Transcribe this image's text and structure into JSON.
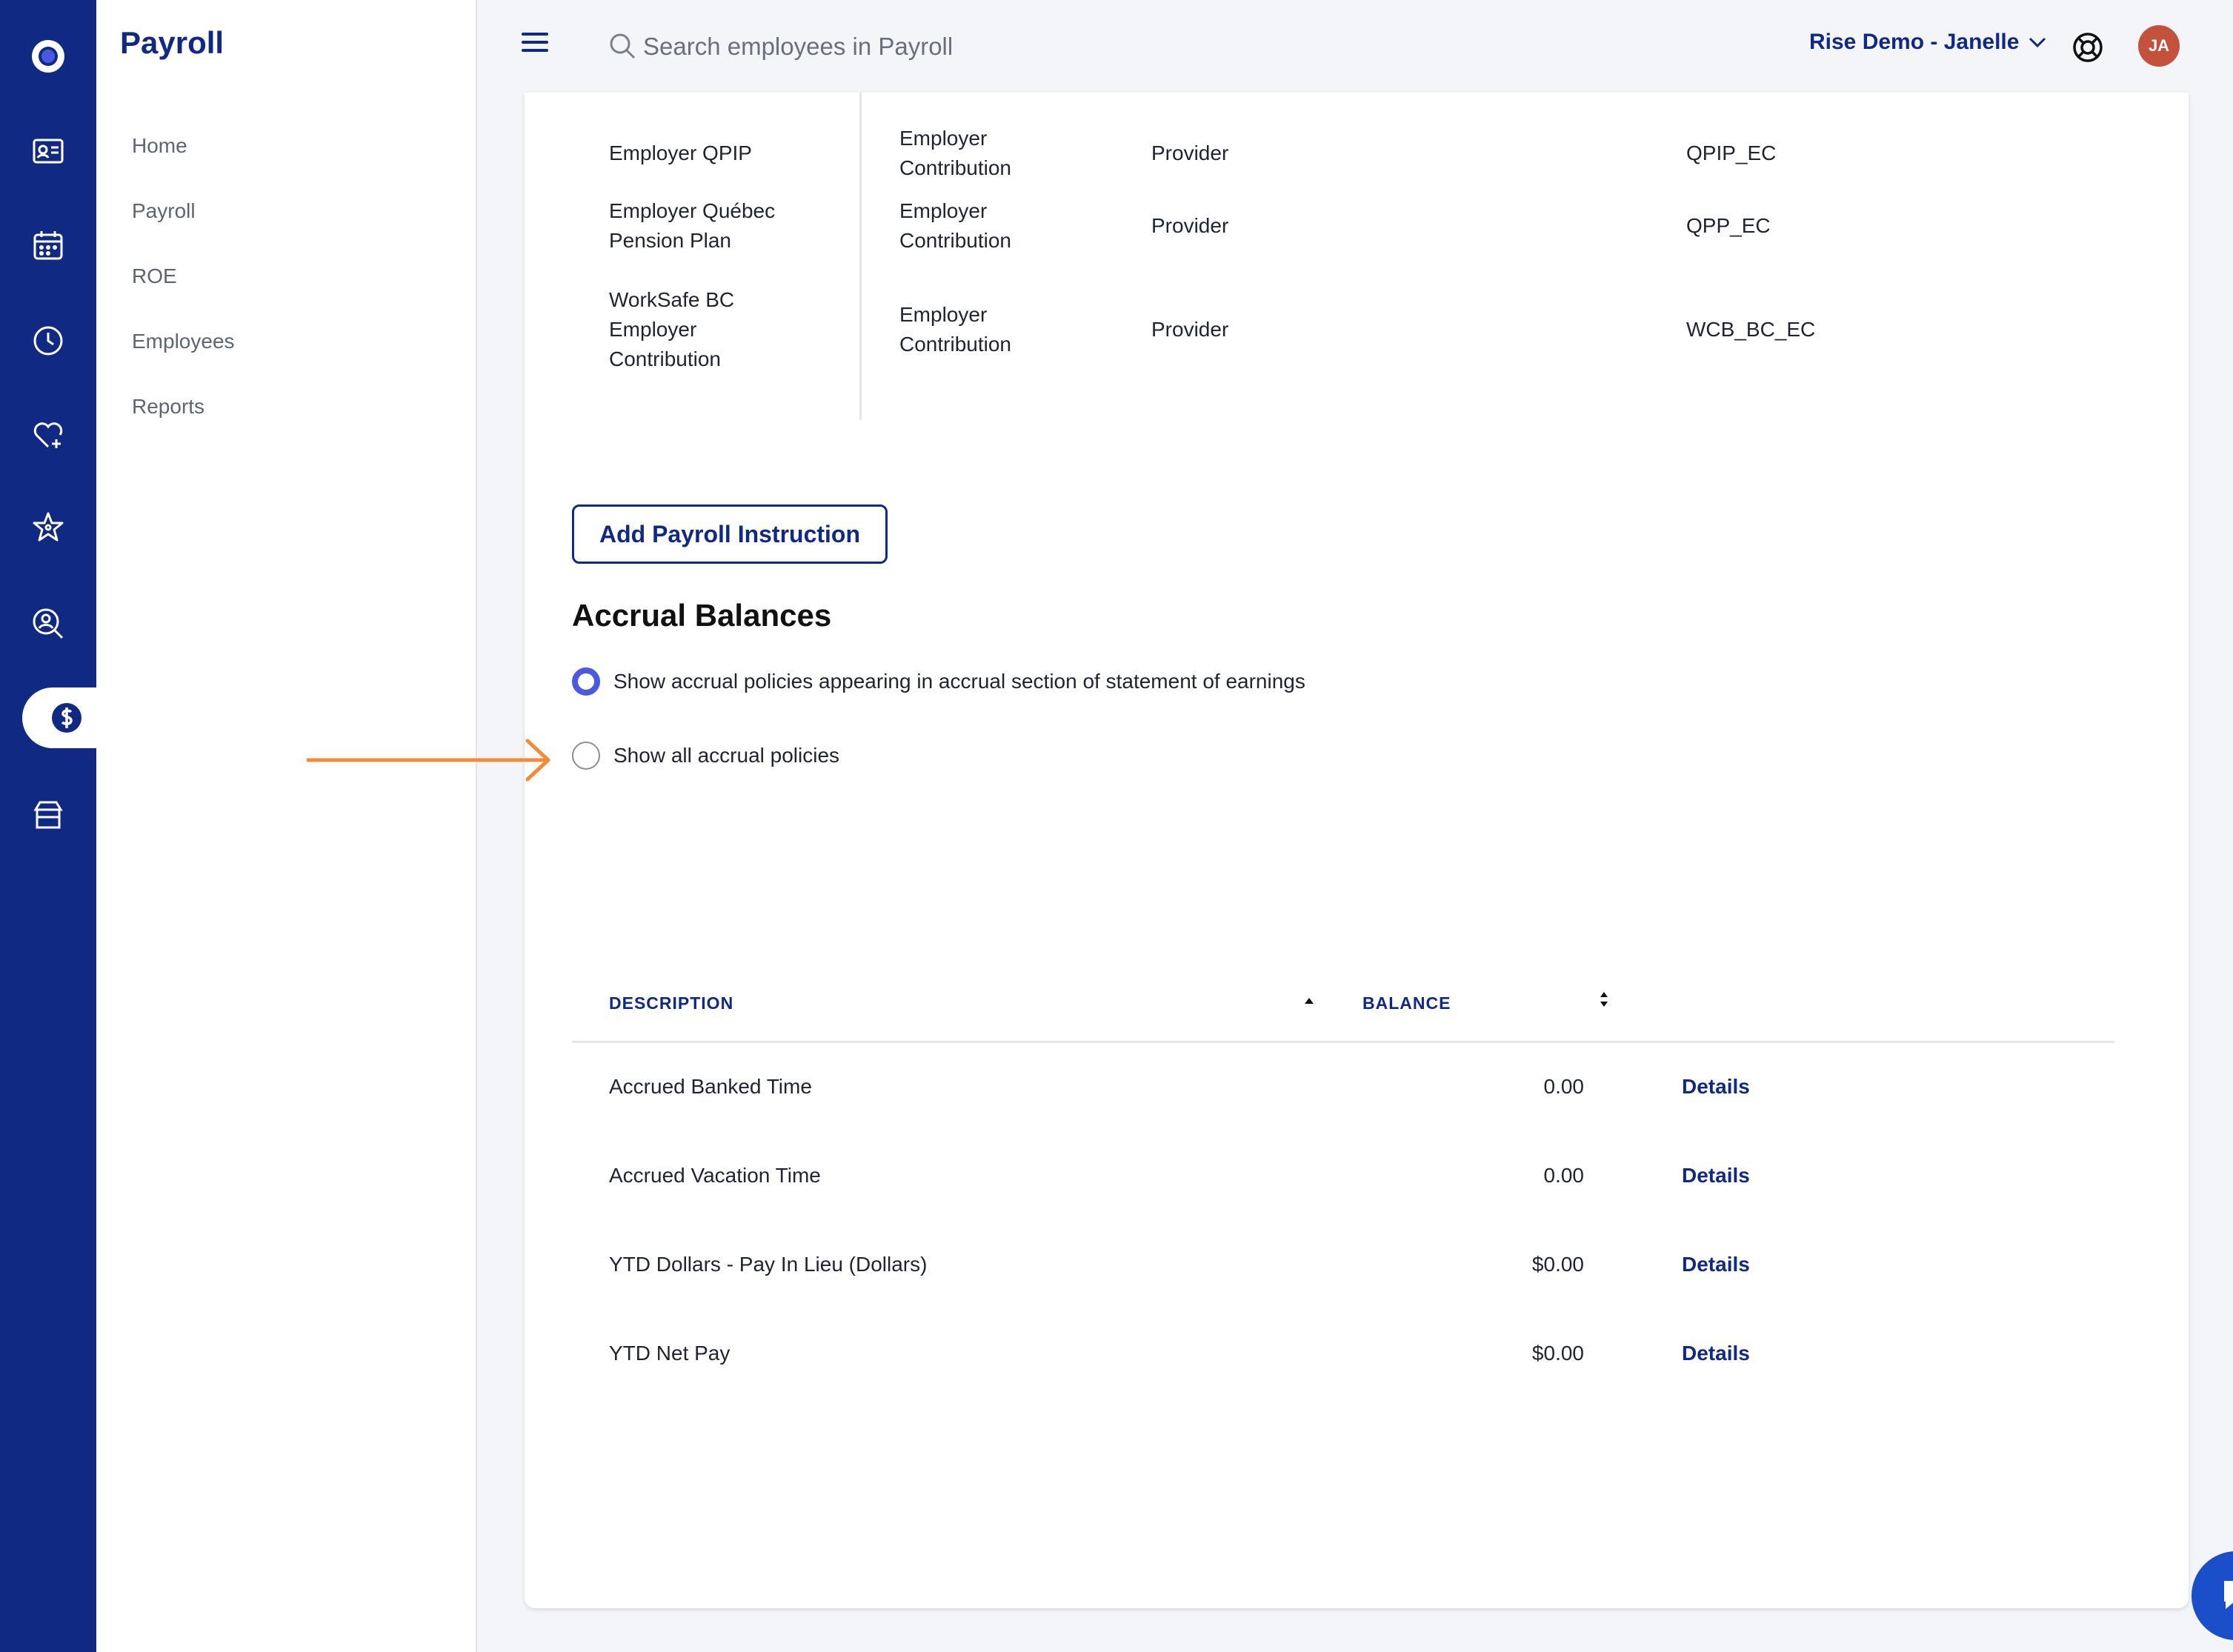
{
  "app": {
    "title": "Payroll",
    "rail_icons": [
      "logo-icon",
      "id-card-icon",
      "calendar-icon",
      "clock-icon",
      "heart-plus-icon",
      "star-icon",
      "person-search-icon",
      "dollar-icon",
      "store-icon"
    ]
  },
  "sidebar": {
    "items": [
      {
        "label": "Home"
      },
      {
        "label": "Payroll"
      },
      {
        "label": "ROE"
      },
      {
        "label": "Employees"
      },
      {
        "label": "Reports"
      }
    ]
  },
  "topbar": {
    "search_placeholder": "Search employees in Payroll",
    "account_label": "Rise Demo - Janelle",
    "avatar_initials": "JA"
  },
  "payroll_instructions": {
    "rows": [
      {
        "name": "Employer QPIP",
        "type": "Employer Contribution",
        "source": "Provider",
        "code": "QPIP_EC"
      },
      {
        "name": "Employer Québec Pension Plan",
        "type": "Employer Contribution",
        "source": "Provider",
        "code": "QPP_EC"
      },
      {
        "name": "WorkSafe BC Employer Contribution",
        "type": "Employer Contribution",
        "source": "Provider",
        "code": "WCB_BC_EC"
      }
    ],
    "add_button_label": "Add Payroll Instruction"
  },
  "accruals": {
    "title": "Accrual Balances",
    "options": [
      {
        "label": "Show accrual policies appearing in accrual section of statement of earnings",
        "checked": true
      },
      {
        "label": "Show all accrual policies",
        "checked": false
      }
    ],
    "columns": {
      "description": "DESCRIPTION",
      "balance": "BALANCE"
    },
    "rows": [
      {
        "description": "Accrued Banked Time",
        "balance": "0.00",
        "link": "Details"
      },
      {
        "description": "Accrued Vacation Time",
        "balance": "0.00",
        "link": "Details"
      },
      {
        "description": "YTD Dollars - Pay In Lieu (Dollars)",
        "balance": "$0.00",
        "link": "Details"
      },
      {
        "description": "YTD Net Pay",
        "balance": "$0.00",
        "link": "Details"
      }
    ]
  },
  "colors": {
    "brand": "#102a83",
    "radio_accent": "#4a59e0",
    "annotation_arrow": "#f28c38",
    "avatar": "#c2523c"
  }
}
